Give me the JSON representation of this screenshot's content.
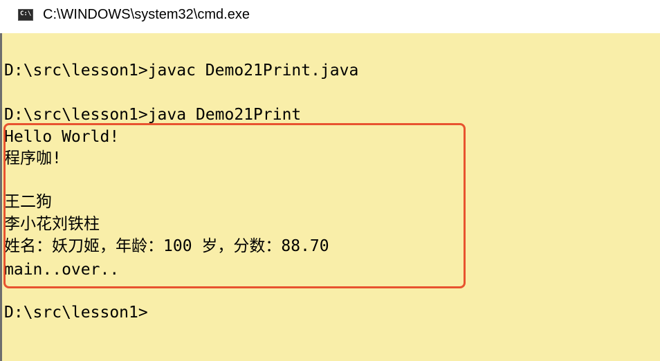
{
  "window": {
    "title": "C:\\WINDOWS\\system32\\cmd.exe",
    "icon": "cmd-icon",
    "icon_text": "C:\\"
  },
  "console": {
    "lines": [
      "D:\\src\\lesson1>javac Demo21Print.java",
      "",
      "D:\\src\\lesson1>java Demo21Print",
      "Hello World!",
      "程序咖!",
      "",
      "王二狗",
      "李小花刘铁柱",
      "姓名：妖刀姬，年龄：100 岁，分数：88.70",
      "main..over..",
      "",
      "D:\\src\\lesson1>"
    ]
  },
  "colors": {
    "background": "#f9eea9",
    "highlight_border": "#e8532f"
  }
}
